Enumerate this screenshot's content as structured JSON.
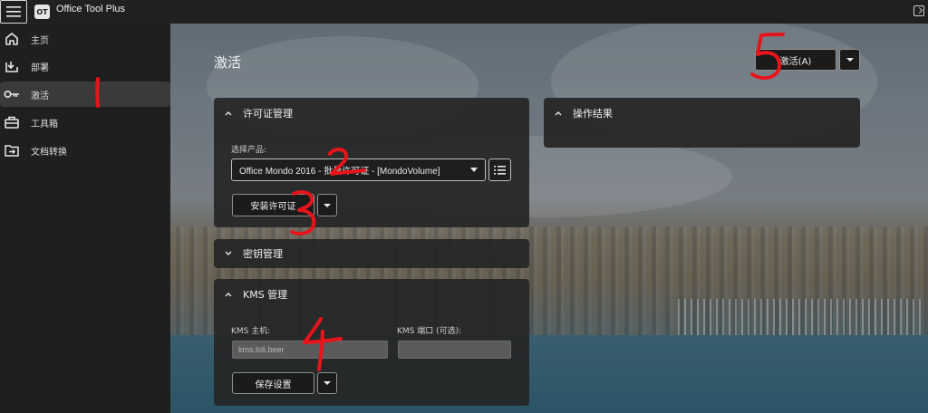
{
  "app": {
    "title": "Office Tool Plus",
    "logo_text": "OT"
  },
  "sidebar": {
    "items": [
      {
        "label": "主页",
        "icon": "home-icon"
      },
      {
        "label": "部署",
        "icon": "deploy-icon"
      },
      {
        "label": "激活",
        "icon": "key-icon",
        "active": true
      },
      {
        "label": "工具箱",
        "icon": "toolbox-icon"
      },
      {
        "label": "文档转换",
        "icon": "convert-icon"
      }
    ]
  },
  "page": {
    "title": "激活",
    "activate_button": "激活(A)"
  },
  "license_card": {
    "title": "许可证管理",
    "product_label": "选择产品:",
    "product_value": "Office Mondo 2016 - 批量许可证 - [MondoVolume]",
    "install_button": "安装许可证"
  },
  "result_card": {
    "title": "操作结果"
  },
  "key_card": {
    "title": "密钥管理"
  },
  "kms_card": {
    "title": "KMS 管理",
    "host_label": "KMS 主机:",
    "host_value": "kms.loli.beer",
    "port_label": "KMS 端口 (可选):",
    "port_value": "",
    "save_button": "保存设置"
  },
  "annotations": [
    "1",
    "2",
    "3",
    "4",
    "5"
  ],
  "colors": {
    "annotation": "#e8141b",
    "sidebar_active": "#3a3a3a",
    "card": "#262626"
  }
}
